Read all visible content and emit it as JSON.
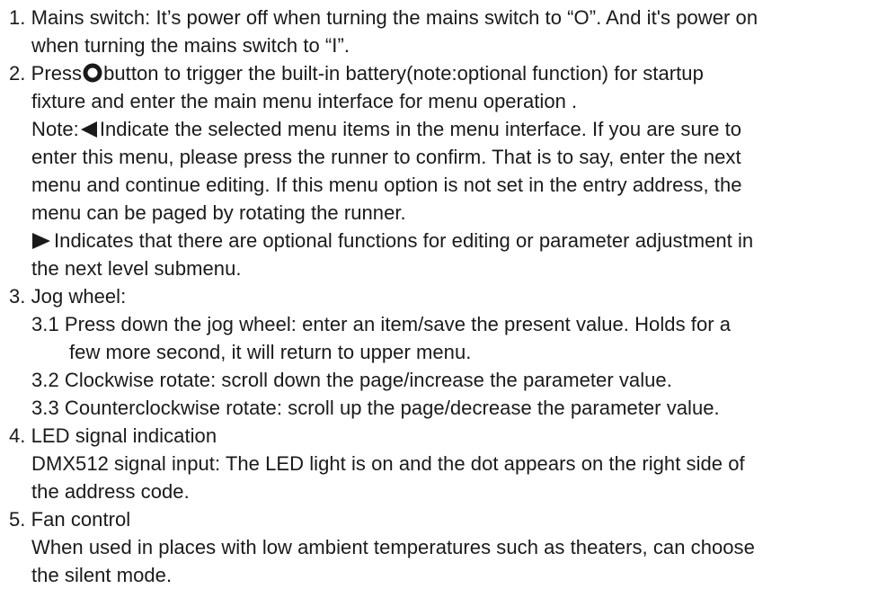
{
  "items": {
    "mains": {
      "line1": "1. Mains switch: It’s power off when turning the mains switch to “O”. And it's power on",
      "line2": "when turning the mains switch to “I”."
    },
    "press": {
      "prefix": "2. Press",
      "line1_rest": "button to trigger the built-in battery(note:optional function) for startup",
      "line2": "fixture and enter the main menu interface for menu operation .",
      "note_prefix": "Note:",
      "note_line1_rest": "Indicate the selected menu items in the menu interface. If you are sure to",
      "note_line2": "enter this menu, please press the runner to confirm. That is to say, enter the next",
      "note_line3": "menu and continue editing. If this menu option is not set in the entry address, the",
      "note_line4": "menu can be paged by rotating the runner.",
      "arrow_line1_rest": "Indicates that there are optional functions for editing or parameter adjustment in",
      "arrow_line2": "the next level submenu."
    },
    "jog": {
      "heading": "3. Jog wheel:",
      "sub1_line1": "3.1 Press down the jog wheel: enter an item/save the present value. Holds for a",
      "sub1_line2": "few more second, it will return to upper menu.",
      "sub2": "3.2 Clockwise rotate: scroll down the page/increase the parameter value.",
      "sub3": "3.3 Counterclockwise rotate: scroll up the page/decrease the parameter value."
    },
    "led": {
      "heading": "4. LED signal indication",
      "line1": "DMX512 signal input: The LED light is on and the dot appears on the right side of",
      "line2": "the address code."
    },
    "fan": {
      "heading": "5. Fan control",
      "line1": "When used in places with low ambient temperatures such as theaters, can choose",
      "line2": "the silent mode."
    }
  },
  "icons": {
    "button": "ring-button-icon",
    "selected": "left-triangle-icon",
    "submenu": "right-triangle-icon"
  },
  "colors": {
    "text": "#1a1a1a",
    "icon": "#1a1a1a"
  }
}
